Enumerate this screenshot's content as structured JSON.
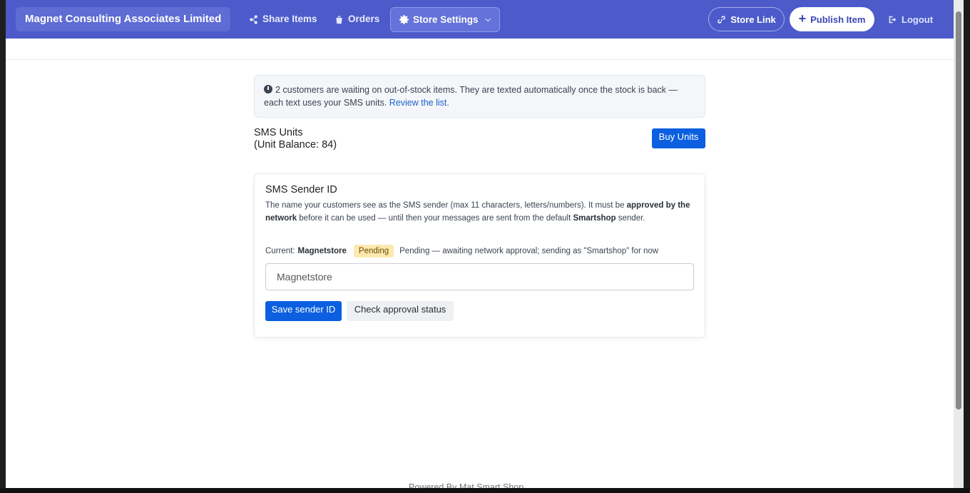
{
  "nav": {
    "brand": "Magnet Consulting Associates Limited",
    "share_items": "Share Items",
    "orders": "Orders",
    "store_settings": "Store Settings",
    "store_link": "Store Link",
    "publish_item": "Publish Item",
    "logout": "Logout"
  },
  "alert": {
    "text": "2 customers are waiting on out-of-stock items. They are texted automatically once the stock is back — each text uses your SMS units.",
    "link": "Review the list."
  },
  "sms_units": {
    "title": "SMS Units",
    "balance_text": "(Unit Balance: 84)",
    "buy_button": "Buy Units"
  },
  "sender_id": {
    "title": "SMS Sender ID",
    "desc_part1": "The name your customers see as the SMS sender (max 11 characters, letters/numbers). It must be ",
    "desc_bold1": "approved by the network",
    "desc_part2": " before it can be used — until then your messages are sent from the default ",
    "desc_bold2": "Smartshop",
    "desc_part3": " sender.",
    "current_label": "Current:",
    "current_value": "Magnetstore",
    "badge": "Pending",
    "status_text": "Pending — awaiting network approval; sending as \"Smartshop\" for now",
    "input_value": "Magnetstore",
    "save_button": "Save sender ID",
    "check_button": "Check approval status"
  },
  "footer": {
    "text": "Powered By Mat Smart Shop"
  }
}
